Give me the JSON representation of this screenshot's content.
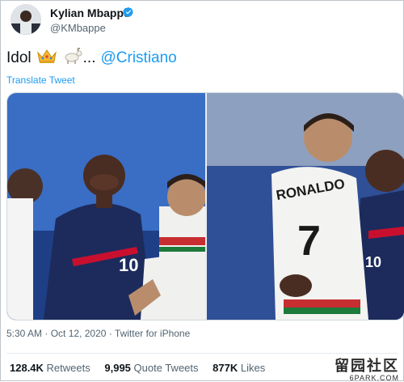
{
  "author": {
    "name": "Kylian Mbappé",
    "handle": "@KMbappe",
    "verified": true
  },
  "tweet": {
    "text_prefix": "Idol",
    "emojis": [
      "crown-emoji",
      "goat-emoji"
    ],
    "ellipsis": "...",
    "mention": "@Cristiano",
    "translate_label": "Translate Tweet"
  },
  "media": {
    "left_photo_jersey": "10",
    "right_photo_name": "RONALDO",
    "right_photo_number": "7"
  },
  "meta": {
    "time": "5:30 AM",
    "date": "Oct 12, 2020",
    "source": "Twitter for iPhone",
    "separator": "·"
  },
  "stats": {
    "retweets_count": "128.4K",
    "retweets_label": "Retweets",
    "quotes_count": "9,995",
    "quotes_label": "Quote Tweets",
    "likes_count": "877K",
    "likes_label": "Likes"
  },
  "watermark": {
    "chinese": "留园社区",
    "url": "6PARK.COM"
  },
  "colors": {
    "link": "#1d9bf0",
    "secondary_text": "#536471",
    "primary_text": "#0f1419"
  }
}
